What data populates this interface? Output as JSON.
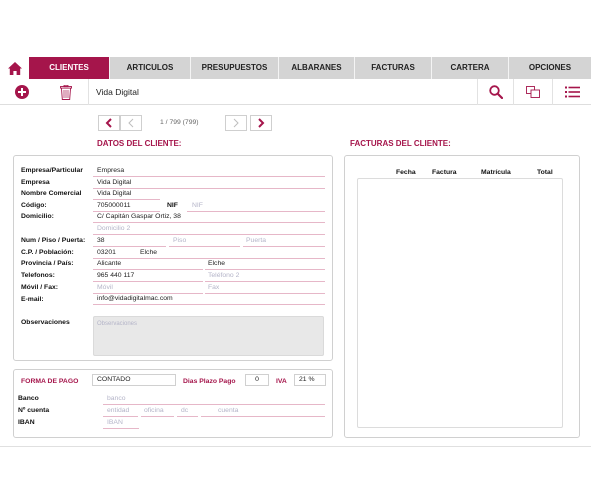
{
  "tabs": [
    {
      "label": "CLIENTES",
      "active": true
    },
    {
      "label": "ARTICULOS"
    },
    {
      "label": "PRESUPUESTOS"
    },
    {
      "label": "ALBARANES"
    },
    {
      "label": "FACTURAS"
    },
    {
      "label": "CARTERA"
    },
    {
      "label": "OPCIONES"
    }
  ],
  "toolbar": {
    "client_name": "Vida Digital"
  },
  "pager": {
    "position": "1 / 799 (799)"
  },
  "client": {
    "section_title": "DATOS DEL CLIENTE:",
    "empresa_particular_label": "Empresa/Particular",
    "empresa_particular": "Empresa",
    "empresa_label": "Empresa",
    "empresa": "Vida Digital",
    "nombre_comercial_label": "Nombre Comercial",
    "nombre_comercial": "Vida Digital",
    "codigo_label": "Código:",
    "codigo": "705000011",
    "nif_label": "NIF",
    "nif_placeholder": "NIF",
    "domicilio_label": "Domicilio:",
    "domicilio": "C/ Capitán Gaspar Ortiz, 38",
    "domicilio2_placeholder": "Domicilio 2",
    "num_piso_puerta_label": "Num / Piso / Puerta:",
    "numero": "38",
    "piso_placeholder": "Piso",
    "puerta_placeholder": "Puerta",
    "cp_poblacion_label": "C.P. / Población:",
    "cp": "03201",
    "poblacion": "Elche",
    "provincia_pais_label": "Provincia / País:",
    "provincia": "Alicante",
    "pais": "Elche",
    "telefonos_label": "Telefonos:",
    "telefono1": "965 440 117",
    "telefono2_placeholder": "Teléfono 2",
    "movil_fax_label": "Móvil / Fax:",
    "movil_placeholder": "Móvil",
    "fax_placeholder": "Fax",
    "email_label": "E-mail:",
    "email": "info@vidadigitalmac.com",
    "observaciones_label": "Observaciones",
    "observaciones_placeholder": "Observaciones"
  },
  "payment": {
    "forma_pago_label": "FORMA DE PAGO",
    "forma_pago": "CONTADO",
    "dias_plazo_label": "Dias Plazo Pago",
    "dias_plazo": "0",
    "iva_label": "IVA",
    "iva": "21 %",
    "banco_label": "Banco",
    "banco_placeholder": "banco",
    "n_cuenta_label": "Nº cuenta",
    "entidad_placeholder": "entidad",
    "oficina_placeholder": "oficina",
    "dc_placeholder": "dc",
    "cuenta_placeholder": "cuenta",
    "iban_label": "IBAN",
    "iban_placeholder": "IBAN"
  },
  "invoices": {
    "section_title": "FACTURAS DEL CLIENTE:",
    "columns": [
      "Fecha",
      "Factura",
      "Matrícula",
      "Total"
    ]
  },
  "colors": {
    "accent": "#a5154b",
    "tab_bg": "#d4d4d4"
  }
}
